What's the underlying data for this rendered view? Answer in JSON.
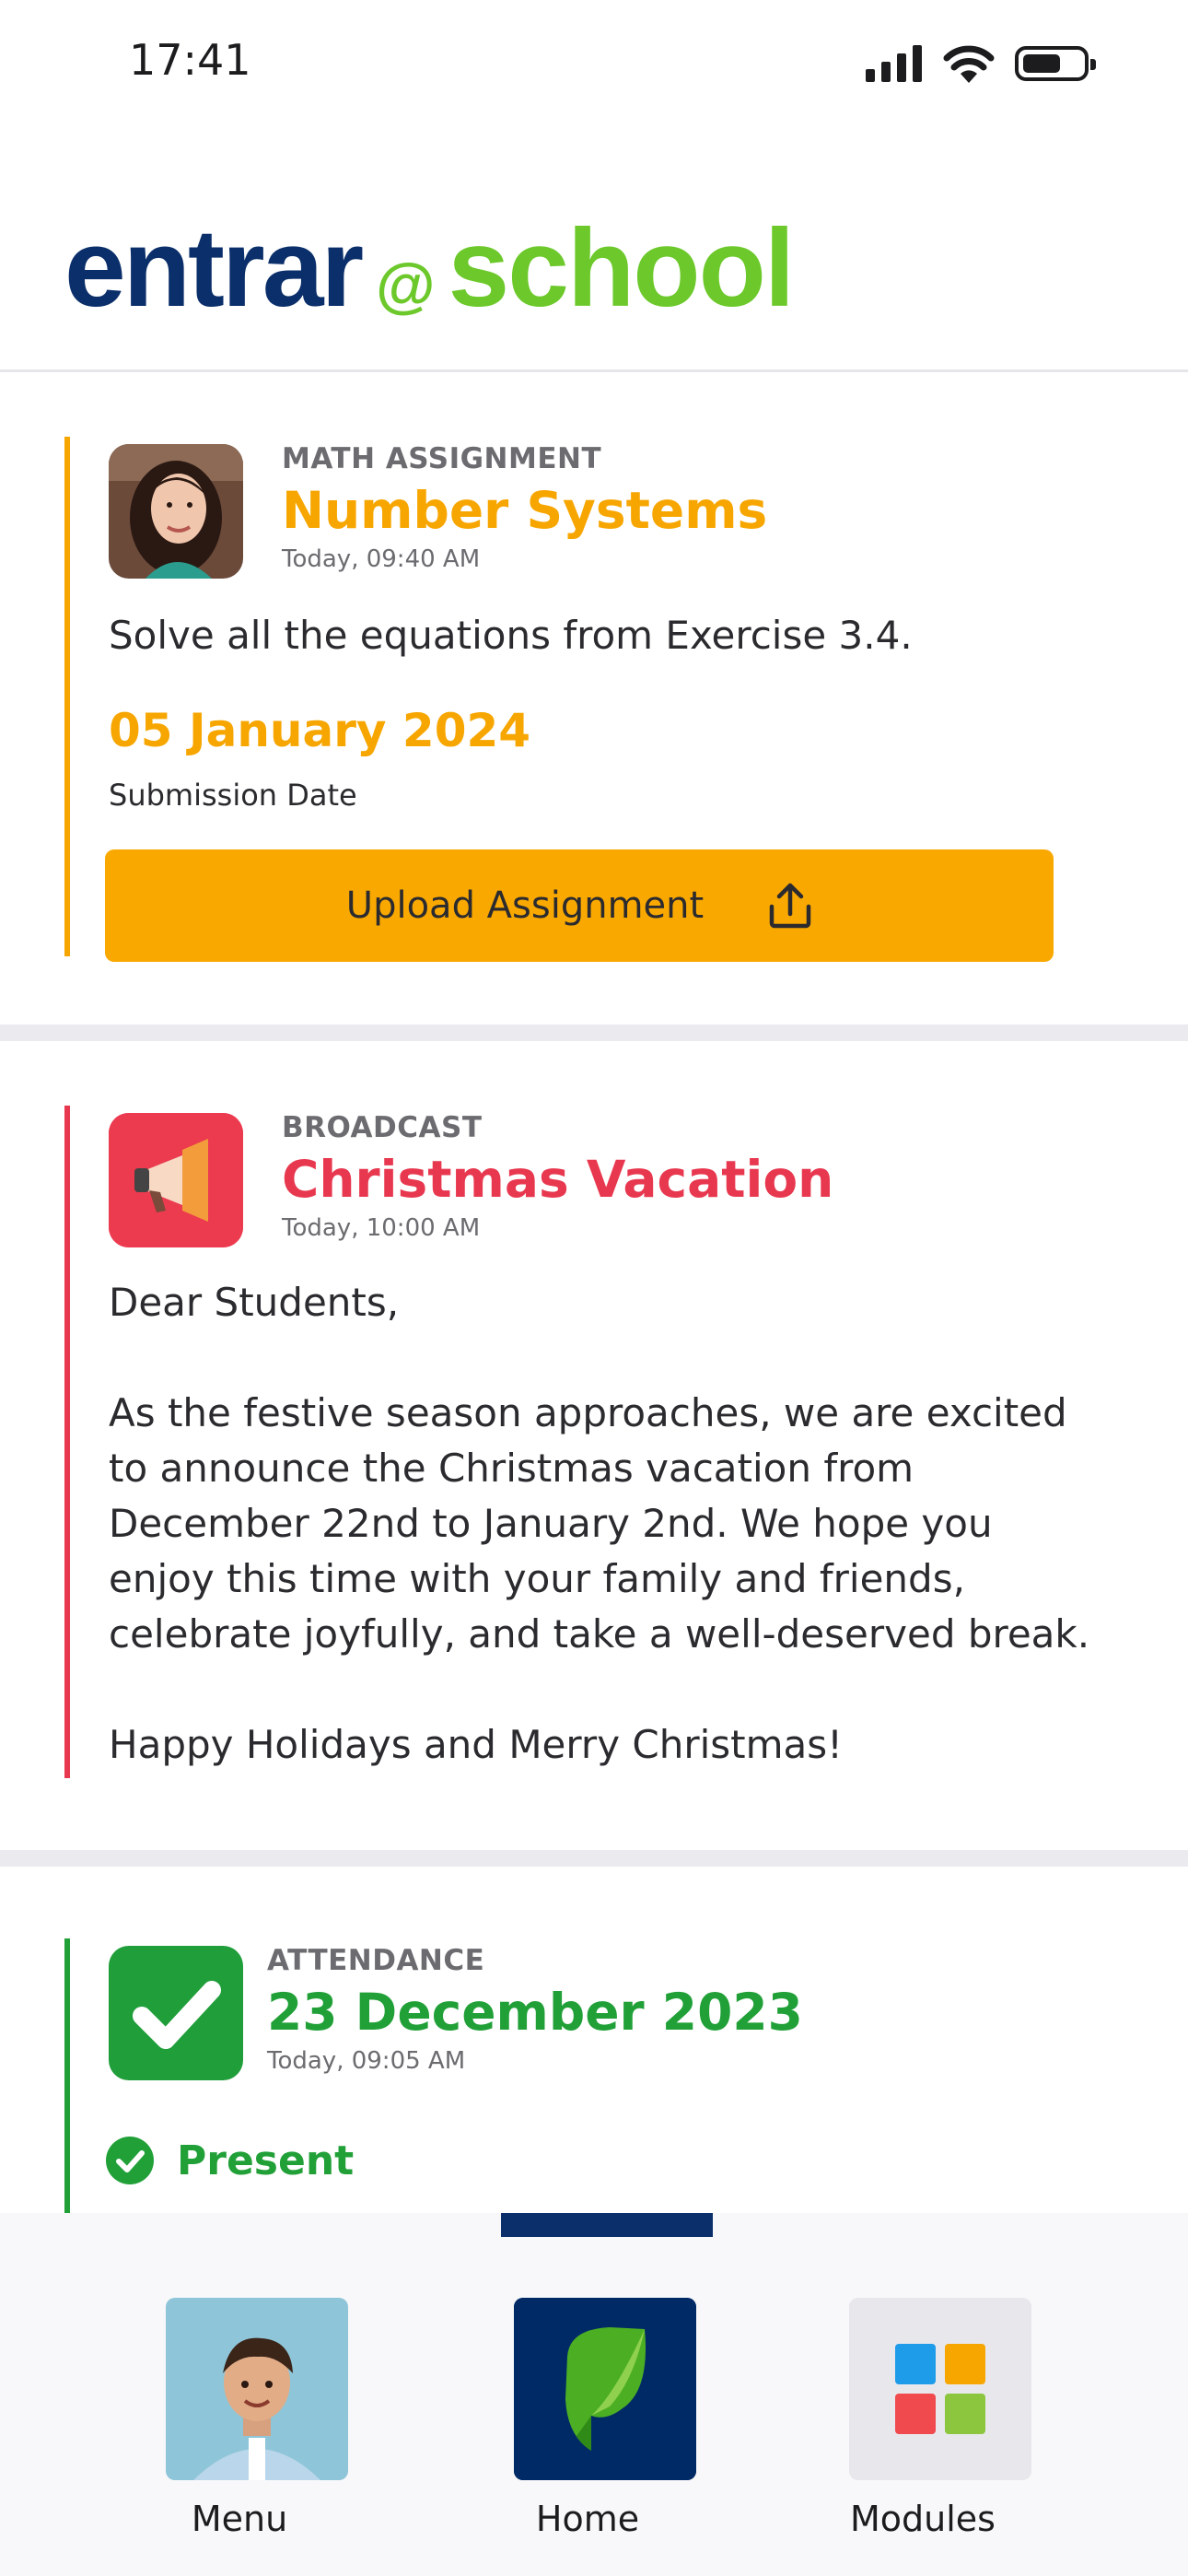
{
  "status_bar": {
    "time": "17:41",
    "battery_level": 0.65,
    "icons": [
      "cellular-signal-icon",
      "wifi-icon",
      "battery-icon"
    ]
  },
  "header": {
    "logo_entrar": "entrar",
    "logo_at": "@",
    "logo_school": "school"
  },
  "feed": [
    {
      "type": "assignment",
      "accent_color": "#f7a600",
      "category": "MATH ASSIGNMENT",
      "title": "Number Systems",
      "timestamp": "Today, 09:40 AM",
      "body": "Solve all the equations from Exercise 3.4.",
      "due_date": "05 January 2024",
      "due_label": "Submission Date",
      "action_label": "Upload Assignment",
      "action_icon": "upload-icon",
      "avatar_icon": "teacher-avatar-icon"
    },
    {
      "type": "broadcast",
      "accent_color": "#e8384f",
      "category": "BROADCAST",
      "title": "Christmas Vacation",
      "timestamp": "Today, 10:00 AM",
      "body": "Dear Students,\n\nAs the festive season approaches, we are excited to announce the Christmas vacation from December 22nd to January 2nd. We hope you enjoy this time with your family and friends, celebrate joyfully, and take a well-deserved break.\n\nHappy Holidays and Merry Christmas!",
      "icon": "megaphone-icon"
    },
    {
      "type": "attendance",
      "accent_color": "#21a038",
      "category": "ATTENDANCE",
      "title": "23 December 2023",
      "timestamp": "Today, 09:05 AM",
      "status": "Present",
      "icon": "checkmark-icon"
    }
  ],
  "bottom_nav": {
    "active": "Home",
    "items": [
      {
        "label": "Menu",
        "icon": "student-avatar-icon"
      },
      {
        "label": "Home",
        "icon": "entrar-leaf-icon"
      },
      {
        "label": "Modules",
        "icon": "modules-grid-icon"
      }
    ]
  },
  "colors": {
    "brand_navy": "#0b2f6a",
    "brand_green": "#6dc92b",
    "assignment": "#f7a600",
    "broadcast": "#e8384f",
    "attendance": "#21a038"
  }
}
